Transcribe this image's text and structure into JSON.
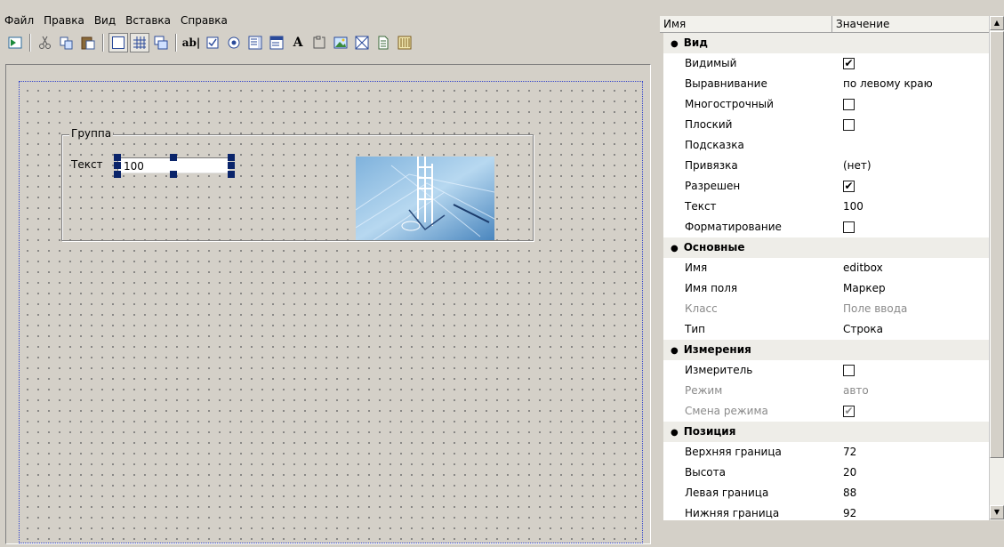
{
  "menu": [
    "Файл",
    "Правка",
    "Вид",
    "Вставка",
    "Справка"
  ],
  "toolbar": {
    "icons": [
      "run-icon",
      "cut-icon",
      "copy-icon",
      "paste-icon",
      "frame-icon",
      "grid-icon",
      "layer-icon",
      "text-label-icon",
      "checkbox-icon",
      "radio-icon",
      "listbox-icon",
      "combobox-icon",
      "static-text-icon",
      "group-icon",
      "picture-icon",
      "image-frame-icon",
      "document-icon",
      "table-icon"
    ],
    "text_label_glyph": "ab|",
    "static_text_glyph": "A"
  },
  "form": {
    "group_label": "Группа",
    "text_label": "Текст",
    "edit_value": "100"
  },
  "props": {
    "header_name": "Имя",
    "header_value": "Значение",
    "rows": [
      {
        "type": "cat",
        "name": "Вид"
      },
      {
        "name": "Видимый",
        "check": true
      },
      {
        "name": "Выравнивание",
        "value": "по левому краю"
      },
      {
        "name": "Многострочный",
        "check": false
      },
      {
        "name": "Плоский",
        "check": false
      },
      {
        "name": "Подсказка",
        "value": ""
      },
      {
        "name": "Привязка",
        "value": "(нет)"
      },
      {
        "name": "Разрешен",
        "check": true
      },
      {
        "name": "Текст",
        "value": "100"
      },
      {
        "name": "Форматирование",
        "check": false
      },
      {
        "type": "cat",
        "name": "Основные"
      },
      {
        "name": "Имя",
        "value": "editbox"
      },
      {
        "name": "Имя поля",
        "value": "Маркер"
      },
      {
        "name": "Класс",
        "value": "Поле ввода",
        "disabled": true
      },
      {
        "name": "Тип",
        "value": "Строка"
      },
      {
        "type": "cat",
        "name": "Измерения"
      },
      {
        "name": "Измеритель",
        "check": false
      },
      {
        "name": "Режим",
        "value": "авто",
        "disabled": true
      },
      {
        "name": "Смена режима",
        "check": true,
        "disabled": true
      },
      {
        "type": "cat",
        "name": "Позиция"
      },
      {
        "name": "Верхняя граница",
        "value": "72"
      },
      {
        "name": "Высота",
        "value": "20"
      },
      {
        "name": "Левая граница",
        "value": "88"
      },
      {
        "name": "Нижняя граница",
        "value": "92"
      }
    ]
  },
  "colors": {
    "selection_handle": "#0a246a",
    "canvas_border": "#3344cc",
    "window_bg": "#d4d0c8"
  }
}
